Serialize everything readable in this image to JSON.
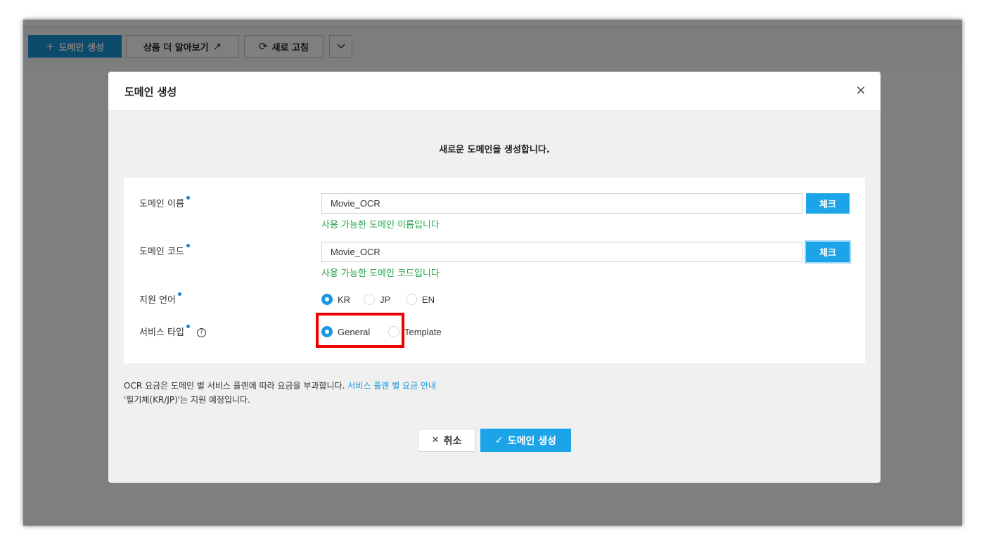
{
  "toolbar": {
    "create_domain": {
      "icon": "plus-icon",
      "glyph": "+",
      "label": "도메인 생성"
    },
    "learn_more": {
      "label": "상품 더 알아보기",
      "icon": "external-link-icon",
      "glyph": "↗"
    },
    "refresh": {
      "icon": "refresh-icon",
      "glyph": "⟳",
      "label": "새로 고침"
    },
    "more": {
      "icon": "chevron-down-icon",
      "glyph": "⌄"
    }
  },
  "modal": {
    "title": "도메인 생성",
    "close_glyph": "×",
    "intro": "새로운 도메인을 생성합니다.",
    "form": {
      "domain_name": {
        "label": "도메인 이름",
        "value": "Movie_OCR",
        "check_label": "체크",
        "status": "사용 가능한 도메인 이름입니다"
      },
      "domain_code": {
        "label": "도메인 코드",
        "value": "Movie_OCR",
        "check_label": "체크",
        "status": "사용 가능한 도메인 코드입니다"
      },
      "languages": {
        "label": "지원 언어",
        "options": [
          "KR",
          "JP",
          "EN"
        ],
        "selected": "KR"
      },
      "service_type": {
        "label": "서비스 타입",
        "help_glyph": "?",
        "options": [
          "General",
          "Template"
        ],
        "selected": "General"
      }
    },
    "notes": {
      "pricing": "OCR 요금은 도메인 별 서비스 플랜에 따라 요금을 부과합니다.",
      "pricing_link": "서비스 플랜 별 요금 안내",
      "handwriting": "'필기체(KR/JP)'는 지원 예정입니다."
    },
    "buttons": {
      "cancel": {
        "glyph": "✕",
        "label": "취소"
      },
      "create": {
        "glyph": "✓",
        "label": "도메인 생성"
      }
    }
  },
  "colors": {
    "primary": "#1ba4e8",
    "success": "#22a54a",
    "highlight": "#ee0000",
    "required_dot": "#1a7ed4"
  }
}
